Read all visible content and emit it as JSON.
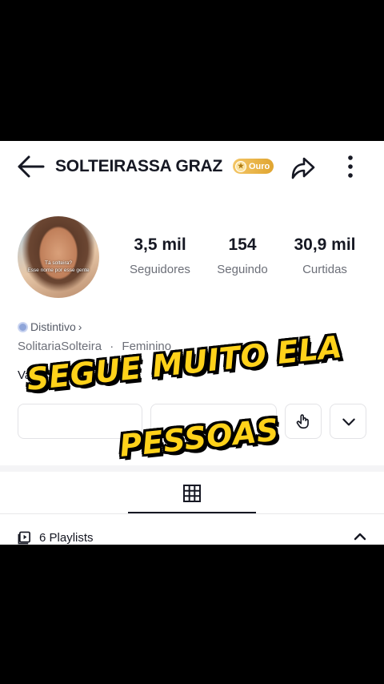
{
  "header": {
    "title": "SOLTEIRASSA GRAZ",
    "badge_label": "Ouro",
    "badge_color": "#E6AC3A"
  },
  "profile": {
    "avatar_caption_line1": "Tá solteira?",
    "avatar_caption_line2": "Esse nome por esse gente",
    "stats": [
      {
        "value": "3,5 mil",
        "label": "Seguidores"
      },
      {
        "value": "154",
        "label": "Seguindo"
      },
      {
        "value": "30,9 mil",
        "label": "Curtidas"
      }
    ],
    "distintivo_label": "Distintivo",
    "distintivo_chevron": "›",
    "username": "SolitariaSolteira",
    "separator": "·",
    "gender": "Feminino",
    "bio": "Vamos 2026? 🥂"
  },
  "tabs": {
    "active": "grid-icon"
  },
  "playlists": {
    "label": "6 Playlists"
  },
  "overlay": {
    "line1": "SEGUE MUITO ELA",
    "line2": "PESSOAS",
    "text_color": "#FFD21A"
  }
}
